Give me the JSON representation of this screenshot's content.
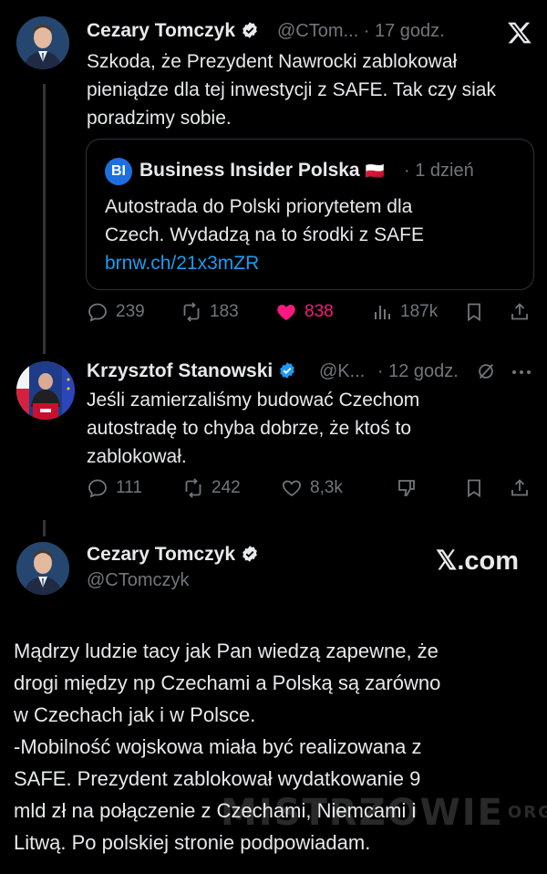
{
  "tweet1": {
    "author_name": "Cezary Tomczyk",
    "handle": "@CTom...",
    "time": "· 17 godz.",
    "text_lines": [
      "Szkoda, że Prezydent Nawrocki zablokował",
      "pieniądze dla tej inwestycji z SAFE. Tak czy siak",
      "poradzimy sobie."
    ],
    "quote": {
      "logo_text": "BI",
      "source_name": "Business Insider Polska",
      "flag": "🇵🇱",
      "time": "· 1 dzień",
      "text_lines": [
        "Autostrada do Polski priorytetem dla",
        "Czech. Wydadzą na to środki z SAFE"
      ],
      "link": "brnw.ch/21x3mZR"
    },
    "actions": {
      "replies": "239",
      "reposts": "183",
      "likes": "838",
      "views": "187k"
    }
  },
  "tweet2": {
    "author_name": "Krzysztof Stanowski",
    "handle": "@K...",
    "time": "· 12 godz.",
    "text_lines": [
      "Jeśli zamierzaliśmy budować Czechom",
      "autostradę to chyba dobrze, że ktoś to",
      "zablokował."
    ],
    "actions": {
      "replies": "111",
      "reposts": "242",
      "likes": "8,3k"
    }
  },
  "tweet3": {
    "author_name": "Cezary Tomczyk",
    "handle": "@CTomczyk",
    "xcom_label": "𝕏.com",
    "text_lines": [
      "Mądrzy ludzie tacy jak Pan wiedzą zapewne, że",
      "drogi między np Czechami a Polską są zarówno",
      "w Czechach jak i w Polsce.",
      "-Mobilność wojskowa miała być realizowana z",
      "SAFE. Prezydent zablokował wydatkowanie 9",
      "mld zł na połączenie z Czechami, Niemcami i",
      "Litwą. Po polskiej stronie podpowiadam."
    ]
  },
  "watermark": {
    "text": "MISTRZOWIE",
    "suffix": "ORG"
  },
  "colors": {
    "accent": "#1d9bf0",
    "like": "#f91880",
    "muted": "#71767b",
    "text": "#e7e9ea",
    "background": "#000000"
  }
}
